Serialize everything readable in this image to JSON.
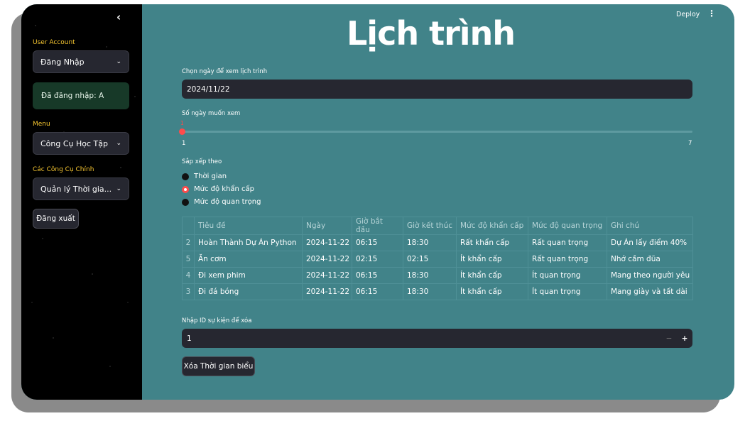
{
  "header": {
    "title": "Lịch trình",
    "deploy_label": "Deploy",
    "menu_icon": "kebab-icon"
  },
  "sidebar": {
    "collapse_icon": "chevron-left-icon",
    "user_account_label": "User Account",
    "user_account_value": "Đăng Nhập",
    "logged_in_text": "Đã đăng nhập: A",
    "menu_label": "Menu",
    "menu_value": "Công Cụ Học Tập",
    "tools_label": "Các Công Cụ Chính",
    "tools_value": "Quản lý Thời gia...",
    "logout_label": "Đăng xuất"
  },
  "main": {
    "date_label": "Chọn ngày để xem lịch trình",
    "date_value": "2024/11/22",
    "days_label": "Số ngày muốn xem",
    "slider": {
      "value": "1",
      "min": "1",
      "max": "7"
    },
    "sort_label": "Sắp xếp theo",
    "sort_options": [
      "Thời gian",
      "Mức độ khẩn cấp",
      "Mức độ quan trọng"
    ],
    "sort_selected": "Mức độ khẩn cấp",
    "table": {
      "columns": [
        "",
        "Tiêu đề",
        "Ngày",
        "Giờ bắt đầu",
        "Giờ kết thúc",
        "Mức độ khẩn cấp",
        "Mức độ quan trọng",
        "Ghi chú"
      ],
      "rows": [
        [
          "2",
          "Hoàn Thành Dự Án Python",
          "2024-11-22",
          "06:15",
          "18:30",
          "Rất khẩn cấp",
          "Rất quan trọng",
          "Dự Án lấy điểm 40%"
        ],
        [
          "5",
          "Ăn cơm",
          "2024-11-22",
          "02:15",
          "02:15",
          "Ít khẩn cấp",
          "Rất quan trọng",
          "Nhớ cầm đũa"
        ],
        [
          "4",
          "Đi xem phim",
          "2024-11-22",
          "06:15",
          "18:30",
          "Ít khẩn cấp",
          "Ít quan trọng",
          "Mang theo người yêu"
        ],
        [
          "3",
          "Đi đá bóng",
          "2024-11-22",
          "06:15",
          "18:30",
          "Ít khẩn cấp",
          "Ít quan trọng",
          "Mang giày và tất dài"
        ]
      ]
    },
    "delete_id_label": "Nhập ID sự kiện để xóa",
    "delete_id_value": "1",
    "stepper_minus": "−",
    "stepper_plus": "+",
    "delete_button": "Xóa Thời gian biểu"
  }
}
